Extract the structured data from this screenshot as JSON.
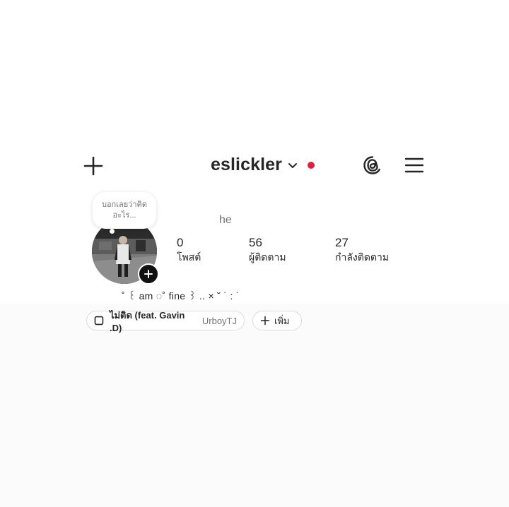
{
  "header": {
    "username": "eslickler",
    "has_notification": true
  },
  "icons": {
    "create": "plus-icon",
    "threads": "threads-icon",
    "menu": "hamburger-menu-icon",
    "switch_account": "chevron-down-icon",
    "add_story": "plus-circle-icon",
    "music": "music-icon"
  },
  "note": {
    "line1": "บอกเลยว่าคิด",
    "line2": "อะไร..."
  },
  "profile": {
    "name": "he",
    "bio": "˚ ꒰ am ◌˚ fine ꒱ .. × ˘ ˙ : ˙"
  },
  "stats": {
    "posts": {
      "count": "0",
      "label": "โพสต์"
    },
    "followers": {
      "count": "56",
      "label": "ผู้ติดตาม"
    },
    "following": {
      "count": "27",
      "label": "กำลังติดตาม"
    }
  },
  "chips": {
    "music_song": "ไม่ติด (feat. Gavin .D)",
    "music_artist": "UrboyTJ",
    "add_label": "เพิ่ม"
  },
  "colors": {
    "notification_dot": "#e0203a",
    "text_primary": "#262626",
    "text_secondary": "#737373"
  }
}
